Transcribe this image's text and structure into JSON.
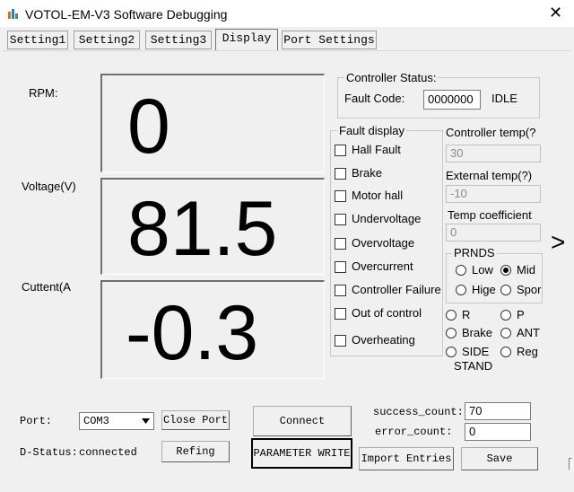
{
  "window": {
    "title": "VOTOL-EM-V3 Software Debugging",
    "close_glyph": "✕"
  },
  "tabs": [
    {
      "label": "Setting1",
      "active": false
    },
    {
      "label": "Setting2",
      "active": false
    },
    {
      "label": "Setting3",
      "active": false
    },
    {
      "label": "Display",
      "active": true
    },
    {
      "label": "Port Settings",
      "active": false
    }
  ],
  "readouts": {
    "rpm_label": "RPM:",
    "rpm_value": "0",
    "voltage_label": "Voltage(V)",
    "voltage_value": "81.5",
    "current_label": "Cuttent(A",
    "current_value": "-0.3"
  },
  "controller_status": {
    "title": "Controller Status:",
    "fault_code_label": "Fault Code:",
    "fault_code_value": "0000000",
    "state": "IDLE"
  },
  "fault_display": {
    "title": "Fault display",
    "items": [
      "Hall Fault",
      "Brake",
      "Motor hall",
      "Undervoltage",
      "Overvoltage",
      "Overcurrent",
      "Controller Failure",
      "Out of control",
      "Overheating"
    ]
  },
  "temps": {
    "controller_label": "Controller temp(?",
    "controller_value": "30",
    "external_label": "External temp(?)",
    "external_value": "-10",
    "coeff_label": "Temp coefficient",
    "coeff_value": "0"
  },
  "prnds": {
    "title": "PRNDS",
    "options": [
      {
        "label": "Low",
        "selected": false
      },
      {
        "label": "Mid",
        "selected": true
      },
      {
        "label": "Hige",
        "selected": false
      },
      {
        "label": "Spor",
        "selected": false
      }
    ]
  },
  "gear": {
    "options": [
      {
        "label": "R",
        "selected": false
      },
      {
        "label": "P",
        "selected": false
      },
      {
        "label": "Brake",
        "selected": false
      },
      {
        "label": "ANT",
        "selected": false
      },
      {
        "label": "SIDE",
        "selected": false
      },
      {
        "label": "Reg",
        "selected": false
      }
    ],
    "side_line2": "STAND"
  },
  "expand_glyph": ">",
  "port": {
    "port_label": "Port:",
    "port_value": "COM3",
    "close_port": "Close Port",
    "status_label": "D-Status:",
    "status_value": "connected",
    "refing": "Refing",
    "connect": "Connect",
    "param_write": "PARAMETER WRITE"
  },
  "counts": {
    "success_label": "success_count:",
    "success_value": "70",
    "error_label": "error_count:",
    "error_value": "0"
  },
  "actions": {
    "import": "Import Entries",
    "save": "Save"
  }
}
